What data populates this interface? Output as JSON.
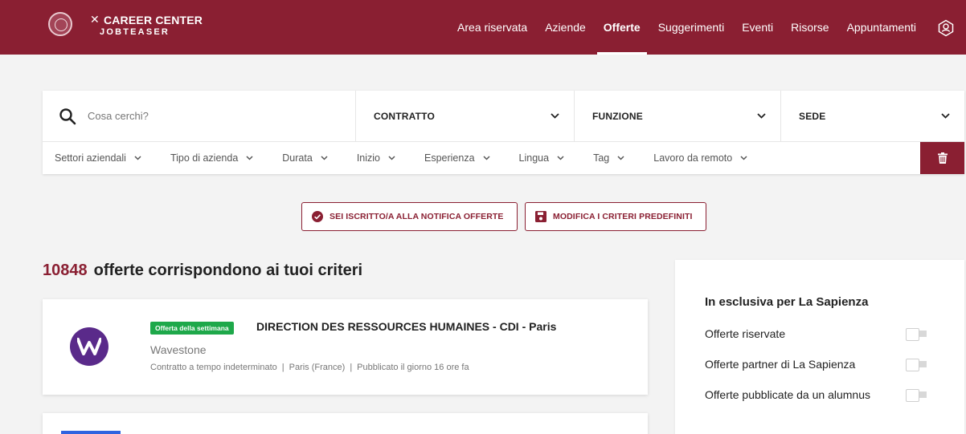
{
  "header": {
    "brand_title": "CAREER CENTER",
    "brand_subtitle": "JOBTEASER",
    "nav": [
      {
        "label": "Area riservata",
        "active": false
      },
      {
        "label": "Aziende",
        "active": false
      },
      {
        "label": "Offerte",
        "active": true
      },
      {
        "label": "Suggerimenti",
        "active": false
      },
      {
        "label": "Eventi",
        "active": false
      },
      {
        "label": "Risorse",
        "active": false
      },
      {
        "label": "Appuntamenti",
        "active": false
      }
    ],
    "profile_icon": "user-circle-icon"
  },
  "filters": {
    "search_placeholder": "Cosa cerchi?",
    "search_value": "",
    "main_dropdowns": [
      "CONTRATTO",
      "FUNZIONE",
      "SEDE"
    ],
    "secondary": [
      "Settori aziendali",
      "Tipo di azienda",
      "Durata",
      "Inizio",
      "Esperienza",
      "Lingua",
      "Tag",
      "Lavoro da remoto"
    ],
    "clear_icon": "trash-icon"
  },
  "actions": {
    "subscribed_label": "SEI ISCRITTO/A ALLA NOTIFICA OFFERTE",
    "edit_criteria_label": "MODIFICA I CRITERI PREDEFINITI"
  },
  "results": {
    "count": "10848",
    "text": "offerte corrispondono ai tuoi criteri"
  },
  "offers": [
    {
      "badge": "Offerta della settimana",
      "title": "DIRECTION DES RESSOURCES HUMAINES - CDI - Paris",
      "company": "Wavestone",
      "contract": "Contratto a tempo indeterminato",
      "location": "Paris (France)",
      "published": "Pubblicato il giorno 16 ore fa",
      "logo_letter": "W"
    }
  ],
  "sidebar": {
    "title": "In esclusiva per La Sapienza",
    "toggles": [
      {
        "label": "Offerte riservate",
        "on": false
      },
      {
        "label": "Offerte partner di La Sapienza",
        "on": false
      },
      {
        "label": "Offerte pubblicate da un alumnus",
        "on": false
      }
    ]
  },
  "colors": {
    "brand": "#8a1f32",
    "badge_green": "#1ea84a",
    "page_bg": "#f3f3f3"
  }
}
